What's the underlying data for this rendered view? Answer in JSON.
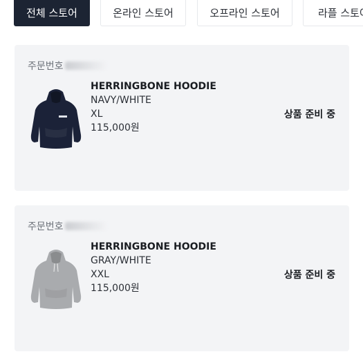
{
  "tabs": [
    {
      "label": "전체 스토어",
      "active": true
    },
    {
      "label": "온라인 스토어",
      "active": false
    },
    {
      "label": "오프라인 스토어",
      "active": false
    },
    {
      "label": "라플 스토어",
      "active": false
    }
  ],
  "orders": [
    {
      "order_number_label": "주문번호",
      "product_name": "HERRINGBONE HOODIE",
      "color": "NAVY/WHITE",
      "size": "XL",
      "price": "115,000원",
      "status": "상품 준비 중",
      "image_icon": "navy-hoodie",
      "image_color": "#1b2238"
    },
    {
      "order_number_label": "주문번호",
      "product_name": "HERRINGBONE HOODIE",
      "color": "GRAY/WHITE",
      "size": "XXL",
      "price": "115,000원",
      "status": "상품 준비 중",
      "image_icon": "gray-hoodie",
      "image_color": "#a9abae"
    }
  ]
}
